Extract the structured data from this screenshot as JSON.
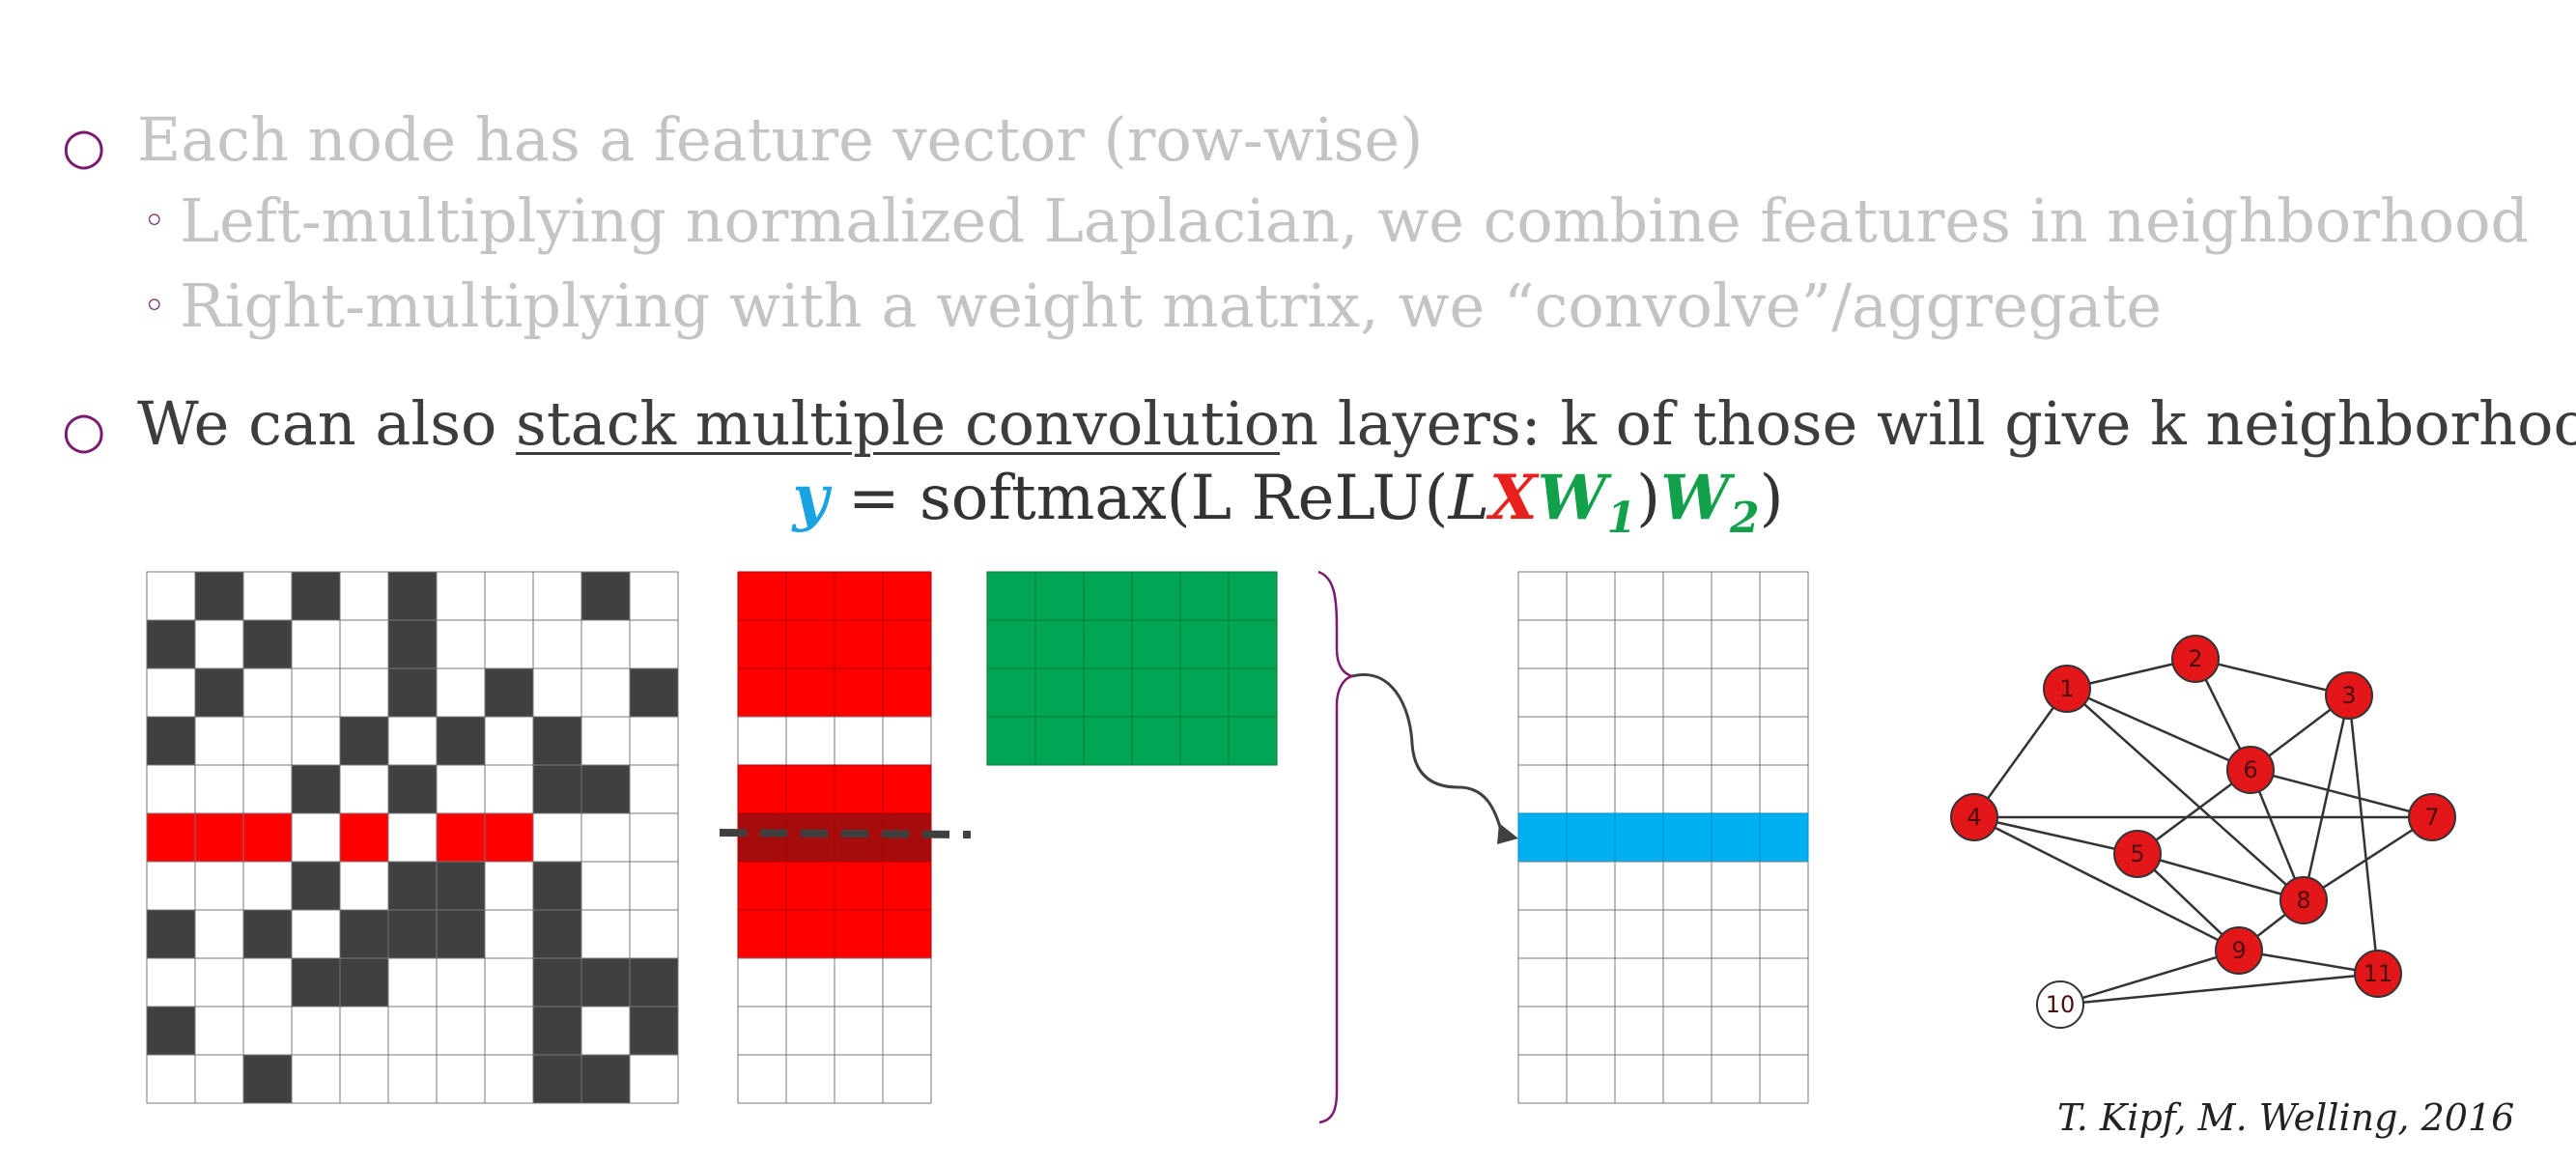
{
  "bullets": {
    "b1": "Each node has a feature vector (row-wise)",
    "b1a": "Left-multiplying normalized Laplacian, we combine features in neighborhood",
    "b1b": "Right-multiplying with a weight matrix, we “convolve”/aggregate",
    "b2_pre": "We can also ",
    "b2_ul": "stack multiple convolutio",
    "b2_post": "n layers: k of those will give k neighborhood"
  },
  "markers": {
    "main": "○",
    "sub": "◦"
  },
  "formula": {
    "y": "y",
    "eq": " = softmax(L ReLU(",
    "L": "L",
    "X": "X",
    "W": "W",
    "sub1": "1",
    "close1": ")",
    "sub2": "2",
    "close2": ")"
  },
  "colors": {
    "red": "#ff0000",
    "dark_red": "#a50d0d",
    "green": "#00a651",
    "blue": "#00b0f0",
    "black_cell": "#404040",
    "purple": "#7b1a6e",
    "faded_text": "#c4c4c4"
  },
  "matrices": {
    "laplacian": {
      "rows": 11,
      "cols": 11,
      "black": [
        "01010100010",
        "10100100000",
        "01000101001",
        "10001010100",
        "00010100110",
        "00000000000",
        "00010110100",
        "10101110100",
        "00011000111",
        "10000000101",
        "00100000110"
      ],
      "highlight_row": 5,
      "red_cells": [
        0,
        1,
        2,
        4,
        6,
        7
      ]
    },
    "features": {
      "rows": 11,
      "cols": 4,
      "red_rows": [
        0,
        1,
        2,
        4,
        5,
        6,
        7
      ],
      "highlight_row": 5
    },
    "weights": {
      "rows": 4,
      "cols": 6
    },
    "output": {
      "rows": 11,
      "cols": 6,
      "blue_row": 5
    }
  },
  "graph": {
    "nodes": [
      {
        "id": "1",
        "label": "1"
      },
      {
        "id": "2",
        "label": "2"
      },
      {
        "id": "3",
        "label": "3"
      },
      {
        "id": "4",
        "label": "4"
      },
      {
        "id": "5",
        "label": "5"
      },
      {
        "id": "6",
        "label": "6"
      },
      {
        "id": "7",
        "label": "7"
      },
      {
        "id": "8",
        "label": "8"
      },
      {
        "id": "9",
        "label": "9"
      },
      {
        "id": "10",
        "label": "10"
      },
      {
        "id": "11",
        "label": "11"
      }
    ],
    "edges": [
      [
        "1",
        "2"
      ],
      [
        "2",
        "3"
      ],
      [
        "1",
        "4"
      ],
      [
        "1",
        "6"
      ],
      [
        "1",
        "8"
      ],
      [
        "2",
        "6"
      ],
      [
        "3",
        "6"
      ],
      [
        "3",
        "8"
      ],
      [
        "3",
        "11"
      ],
      [
        "4",
        "7"
      ],
      [
        "4",
        "5"
      ],
      [
        "4",
        "9"
      ],
      [
        "6",
        "5"
      ],
      [
        "6",
        "7"
      ],
      [
        "6",
        "8"
      ],
      [
        "5",
        "8"
      ],
      [
        "5",
        "9"
      ],
      [
        "7",
        "8"
      ],
      [
        "8",
        "9"
      ],
      [
        "9",
        "11"
      ],
      [
        "9",
        "10"
      ],
      [
        "10",
        "11"
      ]
    ]
  },
  "citation": "T. Kipf, M. Welling, 2016"
}
